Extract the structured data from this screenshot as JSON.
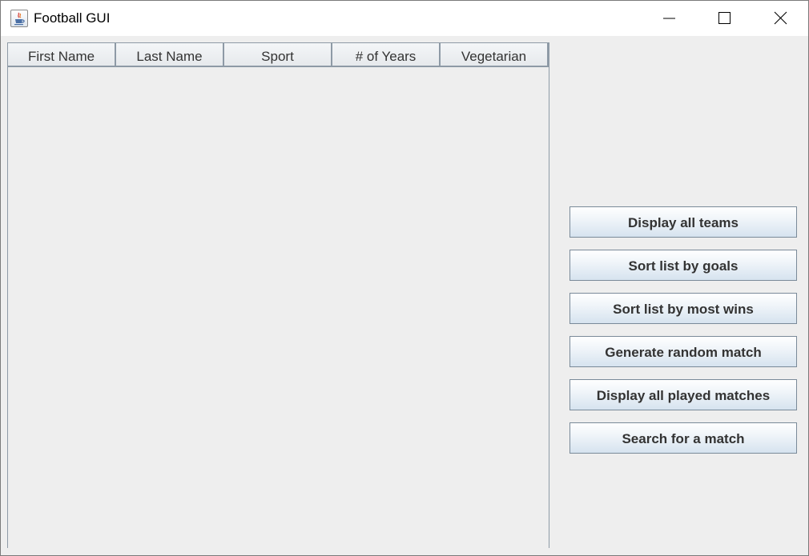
{
  "window": {
    "title": "Football GUI",
    "app_icon": "java-cup-icon"
  },
  "window_controls": {
    "minimize": "minimize-icon",
    "maximize": "maximize-icon",
    "close": "close-icon"
  },
  "table": {
    "columns": [
      "First Name",
      "Last Name",
      "Sport",
      "# of Years",
      "Vegetarian"
    ],
    "rows": []
  },
  "buttons": [
    "Display all teams",
    "Sort list by goals",
    "Sort list by most wins",
    "Generate random match",
    "Display all played matches",
    "Search for a match"
  ],
  "colors": {
    "window_background": "#eeeeee",
    "titlebar_background": "#ffffff",
    "button_gradient_top": "#ffffff",
    "button_gradient_bottom": "#d6e3ef",
    "border": "#8e9aa6"
  }
}
